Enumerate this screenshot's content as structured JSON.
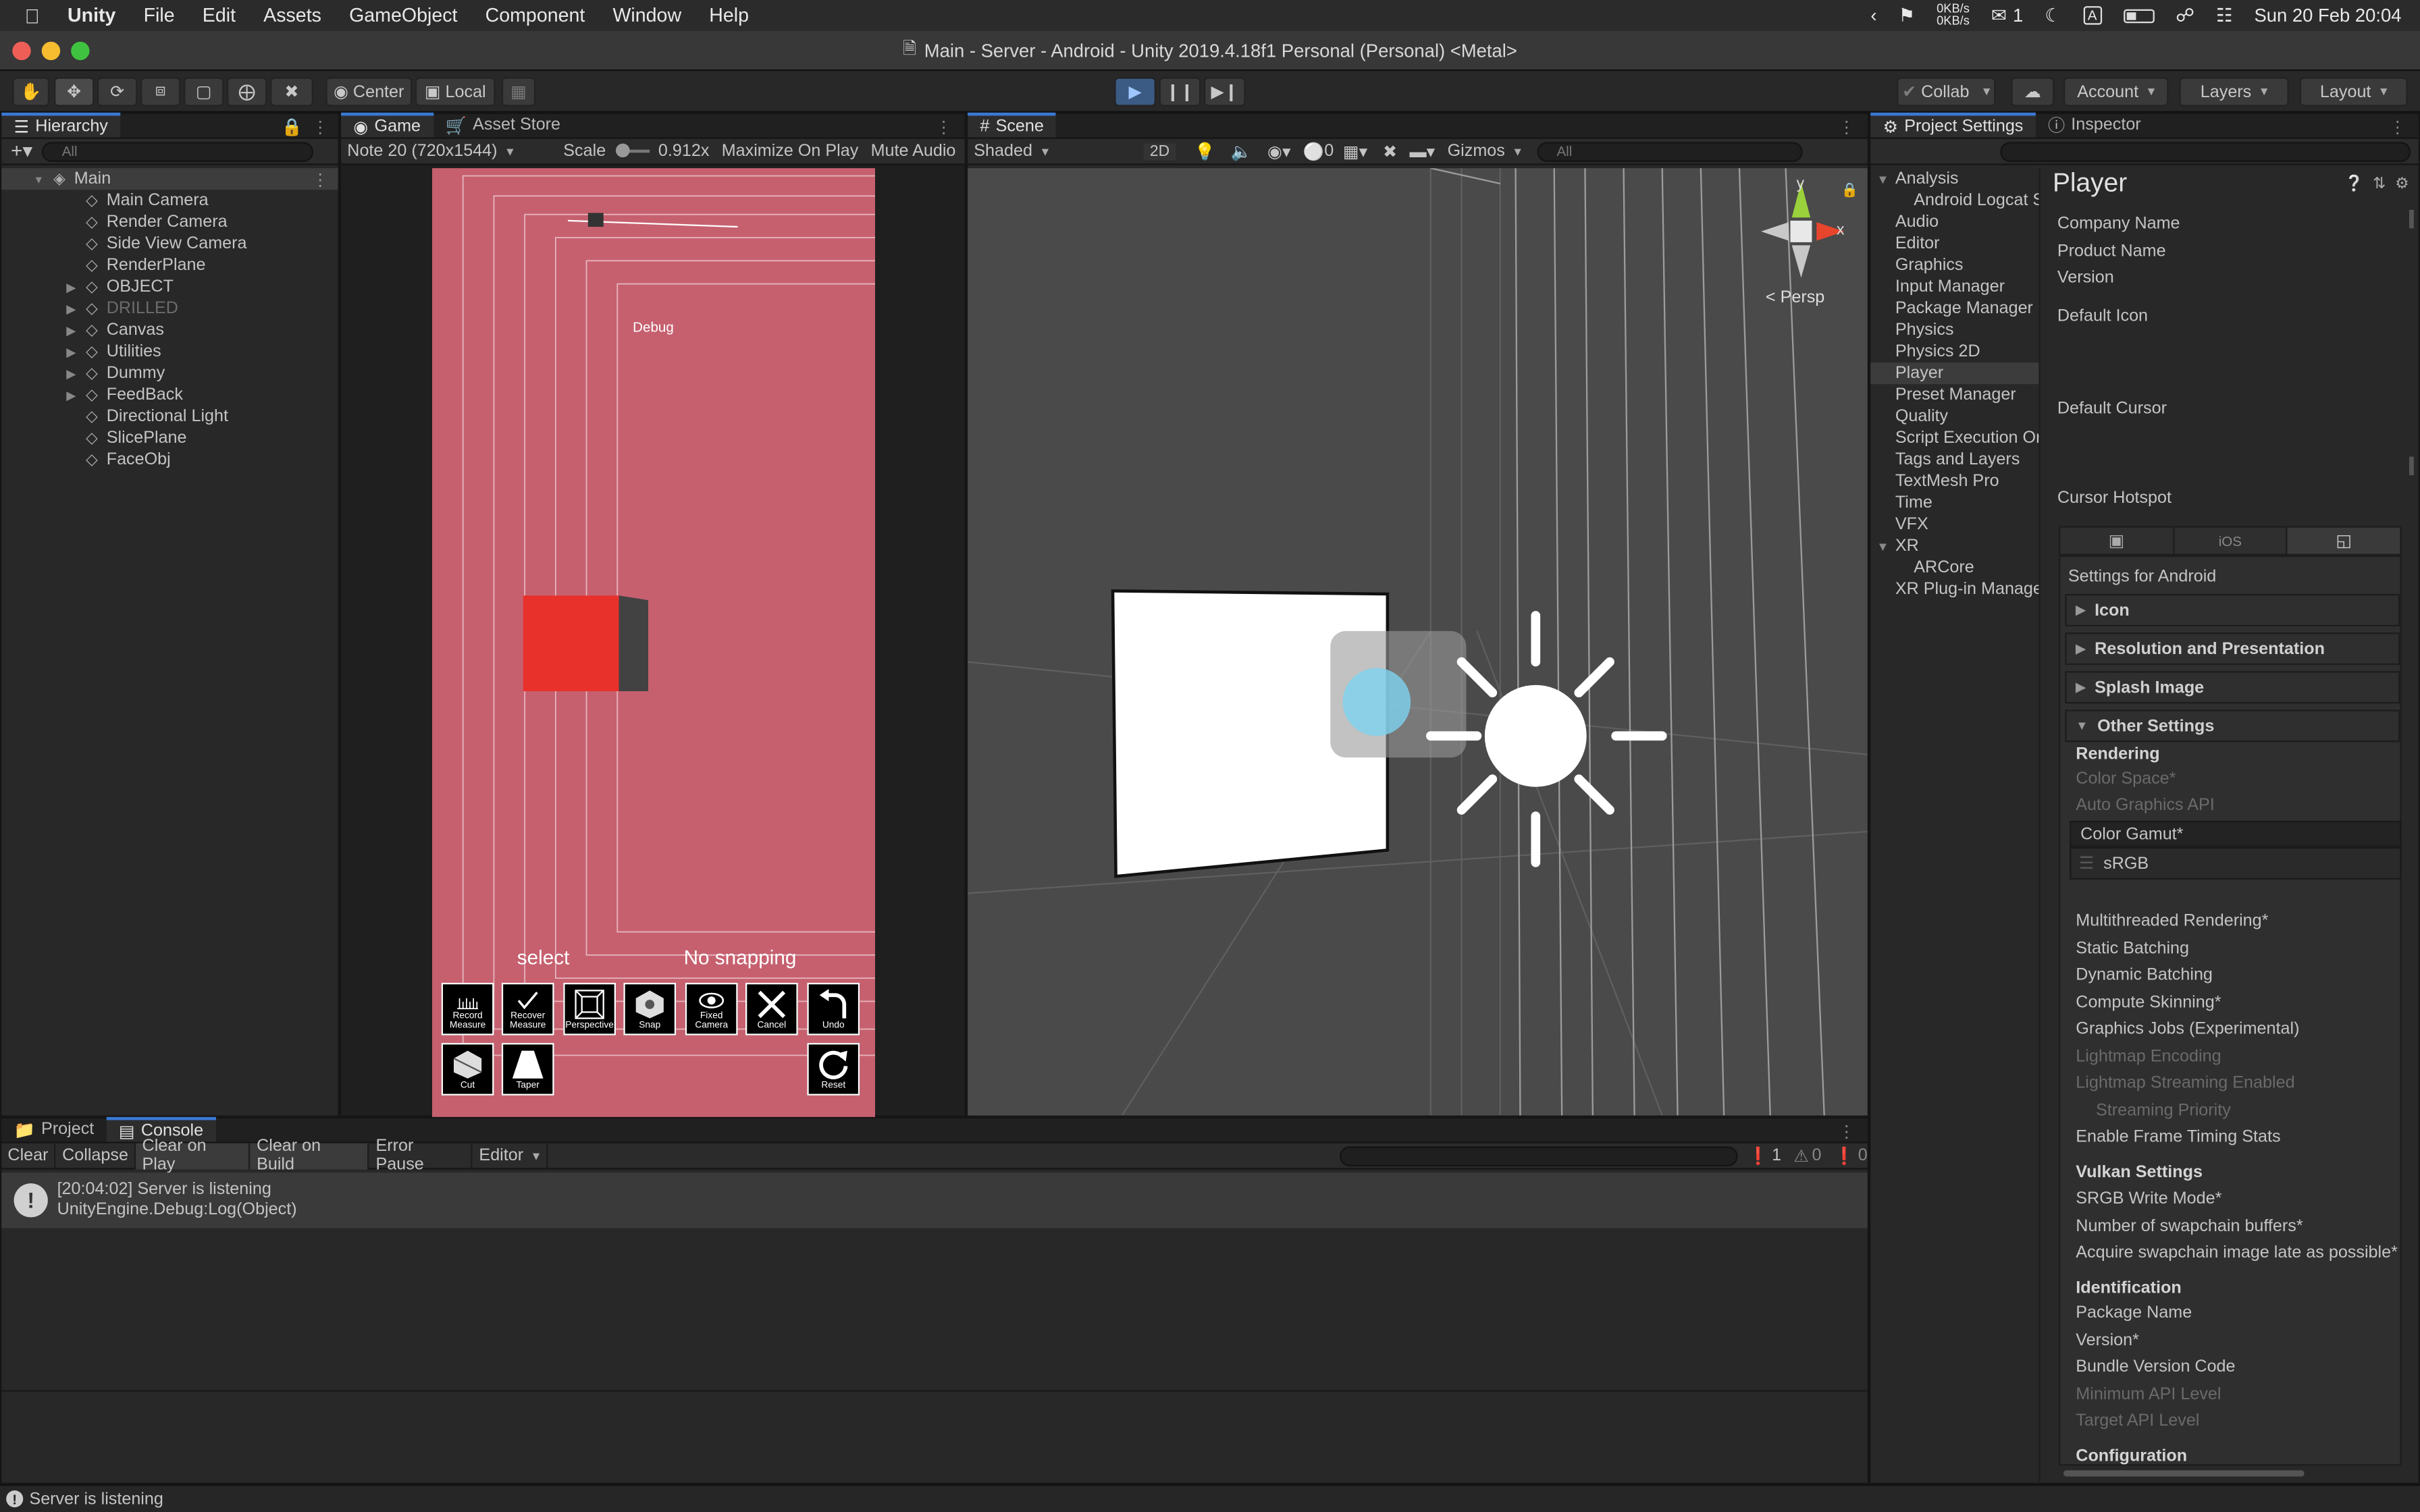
{
  "menubar": {
    "app": "Unity",
    "items": [
      "File",
      "Edit",
      "Assets",
      "GameObject",
      "Component",
      "Window",
      "Help"
    ],
    "net_up": "0KB/s",
    "net_down": "0KB/s",
    "wechat_count": "1",
    "datetime": "Sun 20 Feb  20:04"
  },
  "window": {
    "title": "Main - Server - Android - Unity 2019.4.18f1 Personal (Personal) <Metal>"
  },
  "toolbar": {
    "pivot": "Center",
    "space": "Local",
    "collab": "Collab",
    "account": "Account",
    "layers": "Layers",
    "layout": "Layout"
  },
  "hierarchy": {
    "tab": "Hierarchy",
    "search_placeholder": "All",
    "scene": "Main",
    "items": [
      {
        "label": "Main Camera",
        "expandable": false,
        "disabled": false
      },
      {
        "label": "Render Camera",
        "expandable": false,
        "disabled": false
      },
      {
        "label": "Side View Camera",
        "expandable": false,
        "disabled": false
      },
      {
        "label": "RenderPlane",
        "expandable": false,
        "disabled": false
      },
      {
        "label": "OBJECT",
        "expandable": true,
        "disabled": false
      },
      {
        "label": "DRILLED",
        "expandable": true,
        "disabled": true
      },
      {
        "label": "Canvas",
        "expandable": true,
        "disabled": false
      },
      {
        "label": "Utilities",
        "expandable": true,
        "disabled": false
      },
      {
        "label": "Dummy",
        "expandable": true,
        "disabled": false
      },
      {
        "label": "FeedBack",
        "expandable": true,
        "disabled": false
      },
      {
        "label": "Directional Light",
        "expandable": false,
        "disabled": false
      },
      {
        "label": "SlicePlane",
        "expandable": false,
        "disabled": false
      },
      {
        "label": "FaceObj",
        "expandable": false,
        "disabled": false
      }
    ]
  },
  "game": {
    "tabs": [
      "Game",
      "Asset Store"
    ],
    "resolution": "Note 20 (720x1544)",
    "scale_label": "Scale",
    "scale_value": "0.912x",
    "maximize": "Maximize On Play",
    "mute": "Mute Audio",
    "debug_text": "Debug",
    "mode_text": "select",
    "snap_text": "No snapping",
    "buttons_row1": [
      "Record Measure",
      "Recover Measure",
      "Perspective",
      "Snap",
      "Fixed Camera",
      "Cancel",
      "Undo"
    ],
    "buttons_row2": [
      "Cut",
      "Taper",
      "Reset"
    ]
  },
  "scene": {
    "tab": "Scene",
    "shading": "Shaded",
    "mode2d": "2D",
    "hidden_count": "0",
    "gizmos": "Gizmos",
    "search_placeholder": "All",
    "persp": "Persp",
    "axis_y": "y",
    "axis_x": "x"
  },
  "project_settings": {
    "tab": "Project Settings",
    "items": [
      {
        "label": "Analysis",
        "indent": 0,
        "fold": true
      },
      {
        "label": "Android Logcat S",
        "indent": 1,
        "fold": false
      },
      {
        "label": "Audio",
        "indent": 0,
        "fold": false
      },
      {
        "label": "Editor",
        "indent": 0,
        "fold": false
      },
      {
        "label": "Graphics",
        "indent": 0,
        "fold": false
      },
      {
        "label": "Input Manager",
        "indent": 0,
        "fold": false
      },
      {
        "label": "Package Manager",
        "indent": 0,
        "fold": false
      },
      {
        "label": "Physics",
        "indent": 0,
        "fold": false
      },
      {
        "label": "Physics 2D",
        "indent": 0,
        "fold": false
      },
      {
        "label": "Player",
        "indent": 0,
        "fold": false,
        "selected": true
      },
      {
        "label": "Preset Manager",
        "indent": 0,
        "fold": false
      },
      {
        "label": "Quality",
        "indent": 0,
        "fold": false
      },
      {
        "label": "Script Execution Or",
        "indent": 0,
        "fold": false
      },
      {
        "label": "Tags and Layers",
        "indent": 0,
        "fold": false
      },
      {
        "label": "TextMesh Pro",
        "indent": 0,
        "fold": false
      },
      {
        "label": "Time",
        "indent": 0,
        "fold": false
      },
      {
        "label": "VFX",
        "indent": 0,
        "fold": false
      },
      {
        "label": "XR",
        "indent": 0,
        "fold": true
      },
      {
        "label": "ARCore",
        "indent": 1,
        "fold": false
      },
      {
        "label": "XR Plug-in Manage",
        "indent": 0,
        "fold": false
      }
    ]
  },
  "inspector": {
    "tab": "Inspector",
    "title": "Player",
    "company_name": "Company Name",
    "product_name": "Product Name",
    "version": "Version",
    "default_icon": "Default Icon",
    "default_cursor": "Default Cursor",
    "cursor_hotspot": "Cursor Hotspot",
    "platform_ios": "iOS",
    "settings_for": "Settings for Android",
    "sections": [
      "Icon",
      "Resolution and Presentation",
      "Splash Image",
      "Other Settings"
    ],
    "rendering": "Rendering",
    "color_space": "Color Space*",
    "auto_graphics_api": "Auto Graphics API",
    "color_gamut": "Color Gamut*",
    "srgb": "sRGB",
    "rows": [
      {
        "label": "Multithreaded Rendering*",
        "dim": false,
        "indent": false
      },
      {
        "label": "Static Batching",
        "dim": false,
        "indent": false
      },
      {
        "label": "Dynamic Batching",
        "dim": false,
        "indent": false
      },
      {
        "label": "Compute Skinning*",
        "dim": false,
        "indent": false
      },
      {
        "label": "Graphics Jobs (Experimental)",
        "dim": false,
        "indent": false
      },
      {
        "label": "Lightmap Encoding",
        "dim": true,
        "indent": false
      },
      {
        "label": "Lightmap Streaming Enabled",
        "dim": true,
        "indent": false
      },
      {
        "label": "Streaming Priority",
        "dim": true,
        "indent": true
      },
      {
        "label": "Enable Frame Timing Stats",
        "dim": false,
        "indent": false
      }
    ],
    "vulkan_settings": "Vulkan Settings",
    "vulkan_rows": [
      "SRGB Write Mode*",
      "Number of swapchain buffers*",
      "Acquire swapchain image late as possible*"
    ],
    "identification": "Identification",
    "ident_rows": [
      {
        "label": "Package Name",
        "dim": false
      },
      {
        "label": "Version*",
        "dim": false
      },
      {
        "label": "Bundle Version Code",
        "dim": false
      },
      {
        "label": "Minimum API Level",
        "dim": true
      },
      {
        "label": "Target API Level",
        "dim": true
      }
    ],
    "configuration": "Configuration"
  },
  "console": {
    "tabs": [
      "Project",
      "Console"
    ],
    "buttons": [
      "Clear",
      "Collapse",
      "Clear on Play",
      "Clear on Build",
      "Error Pause",
      "Editor"
    ],
    "count_log": "1",
    "count_warn": "0",
    "count_err": "0",
    "entry_line1": "[20:04:02] Server is listening",
    "entry_line2": "UnityEngine.Debug:Log(Object)"
  },
  "statusbar": {
    "text": "Server is listening"
  },
  "colors": {
    "accent": "#3a79d6",
    "game_bg": "#c6606f",
    "cube": "#e8312a"
  }
}
